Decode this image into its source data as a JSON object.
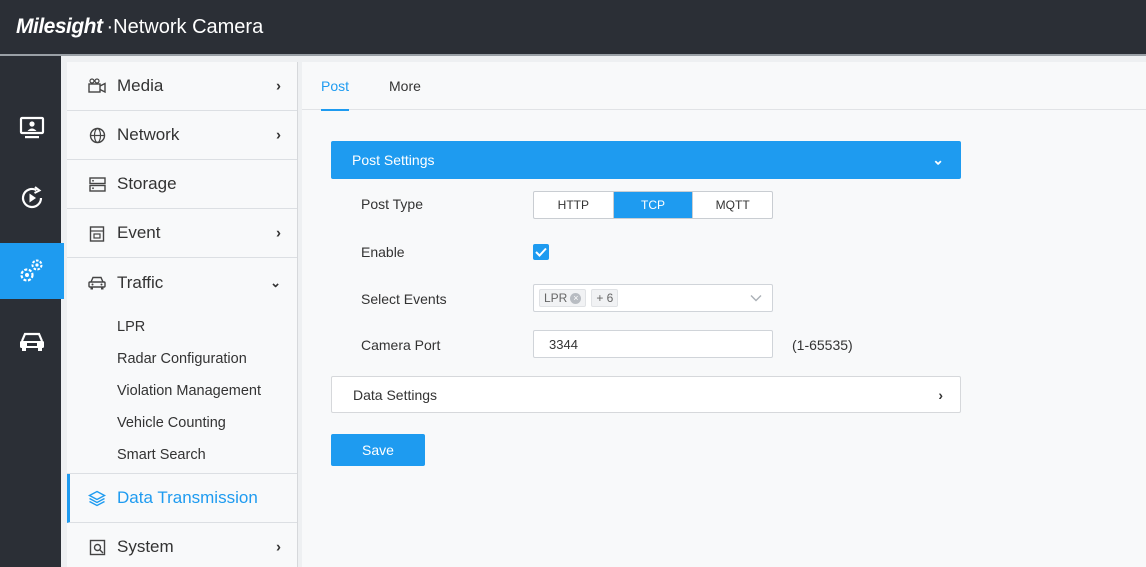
{
  "header": {
    "brand": "Milesight",
    "product": "·Network Camera"
  },
  "rail": {
    "items": [
      {
        "icon": "live-view-icon",
        "active": false
      },
      {
        "icon": "playback-icon",
        "active": false
      },
      {
        "icon": "settings-icon",
        "active": true
      },
      {
        "icon": "vehicle-icon",
        "active": false
      }
    ]
  },
  "menu": {
    "media": "Media",
    "network": "Network",
    "storage": "Storage",
    "event": "Event",
    "traffic": "Traffic",
    "traffic_sub": [
      "LPR",
      "Radar Configuration",
      "Violation Management",
      "Vehicle Counting",
      "Smart Search"
    ],
    "data_transmission": "Data Transmission",
    "system": "System"
  },
  "tabs": {
    "post": "Post",
    "more": "More"
  },
  "post_settings": {
    "title": "Post Settings",
    "post_type_label": "Post Type",
    "post_type_options": [
      "HTTP",
      "TCP",
      "MQTT"
    ],
    "post_type_selected": "TCP",
    "enable_label": "Enable",
    "enable_checked": true,
    "select_events_label": "Select Events",
    "events_tag": "LPR",
    "events_more": "+ 6",
    "camera_port_label": "Camera Port",
    "camera_port_value": "3344",
    "camera_port_range": "(1-65535)"
  },
  "data_settings": {
    "title": "Data Settings"
  },
  "actions": {
    "save": "Save"
  },
  "colors": {
    "accent": "#1e9bf0",
    "header_bg": "#2b2f36"
  }
}
